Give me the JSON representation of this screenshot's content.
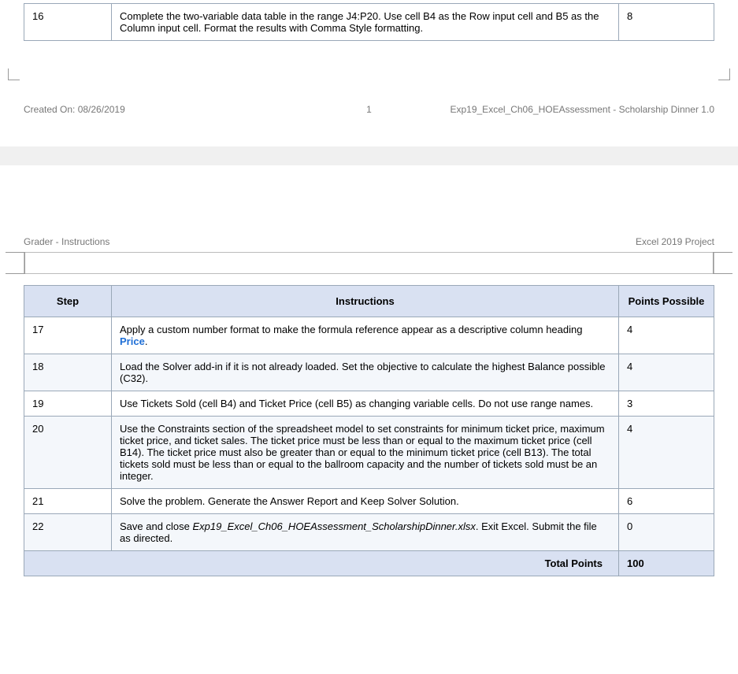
{
  "page1": {
    "row": {
      "step": "16",
      "instruction": "Complete the two-variable data table in the range J4:P20. Use cell B4 as the Row input cell and B5 as the Column input cell. Format the results with Comma Style formatting.",
      "points": "8"
    },
    "footer": {
      "created": "Created On: 08/26/2019",
      "page_num": "1",
      "title": "Exp19_Excel_Ch06_HOEAssessment - Scholarship Dinner 1.0"
    }
  },
  "page2": {
    "header": {
      "left": "Grader - Instructions",
      "right": "Excel 2019 Project"
    },
    "columns": {
      "step": "Step",
      "inst": "Instructions",
      "pts": "Points Possible"
    },
    "rows": [
      {
        "step": "17",
        "inst_pre": "Apply a custom number format to make the formula reference appear as a descriptive column heading ",
        "inst_bold": "Price",
        "inst_post": ".",
        "points": "4",
        "shade": false
      },
      {
        "step": "18",
        "inst_pre": "Load the Solver add-in if it is not already loaded. Set the objective to calculate the highest Balance possible (C32).",
        "inst_bold": "",
        "inst_post": "",
        "points": "4",
        "shade": true
      },
      {
        "step": "19",
        "inst_pre": "Use Tickets Sold (cell B4) and Ticket Price (cell B5) as changing variable cells. Do not use range names.",
        "inst_bold": "",
        "inst_post": "",
        "points": "3",
        "shade": false
      },
      {
        "step": "20",
        "inst_pre": "Use the Constraints section of the spreadsheet model to set constraints for minimum ticket price, maximum ticket price, and ticket sales. The ticket price must be less than or equal to the maximum ticket price (cell B14). The ticket price must also be greater than or equal to the minimum ticket price (cell B13). The total tickets sold must be less than or equal to the ballroom capacity and the number of tickets sold must be an integer.",
        "inst_bold": "",
        "inst_post": "",
        "points": "4",
        "shade": true
      },
      {
        "step": "21",
        "inst_pre": "Solve the problem. Generate the Answer Report and Keep Solver Solution.",
        "inst_bold": "",
        "inst_post": "",
        "points": "6",
        "shade": false
      },
      {
        "step": "22",
        "inst_pre": "Save and close ",
        "inst_italic": "Exp19_Excel_Ch06_HOEAssessment_ScholarshipDinner.xlsx",
        "inst_post2": ". Exit Excel. Submit the file as directed.",
        "points": "0",
        "shade": true
      }
    ],
    "total": {
      "label": "Total Points",
      "value": "100"
    }
  }
}
